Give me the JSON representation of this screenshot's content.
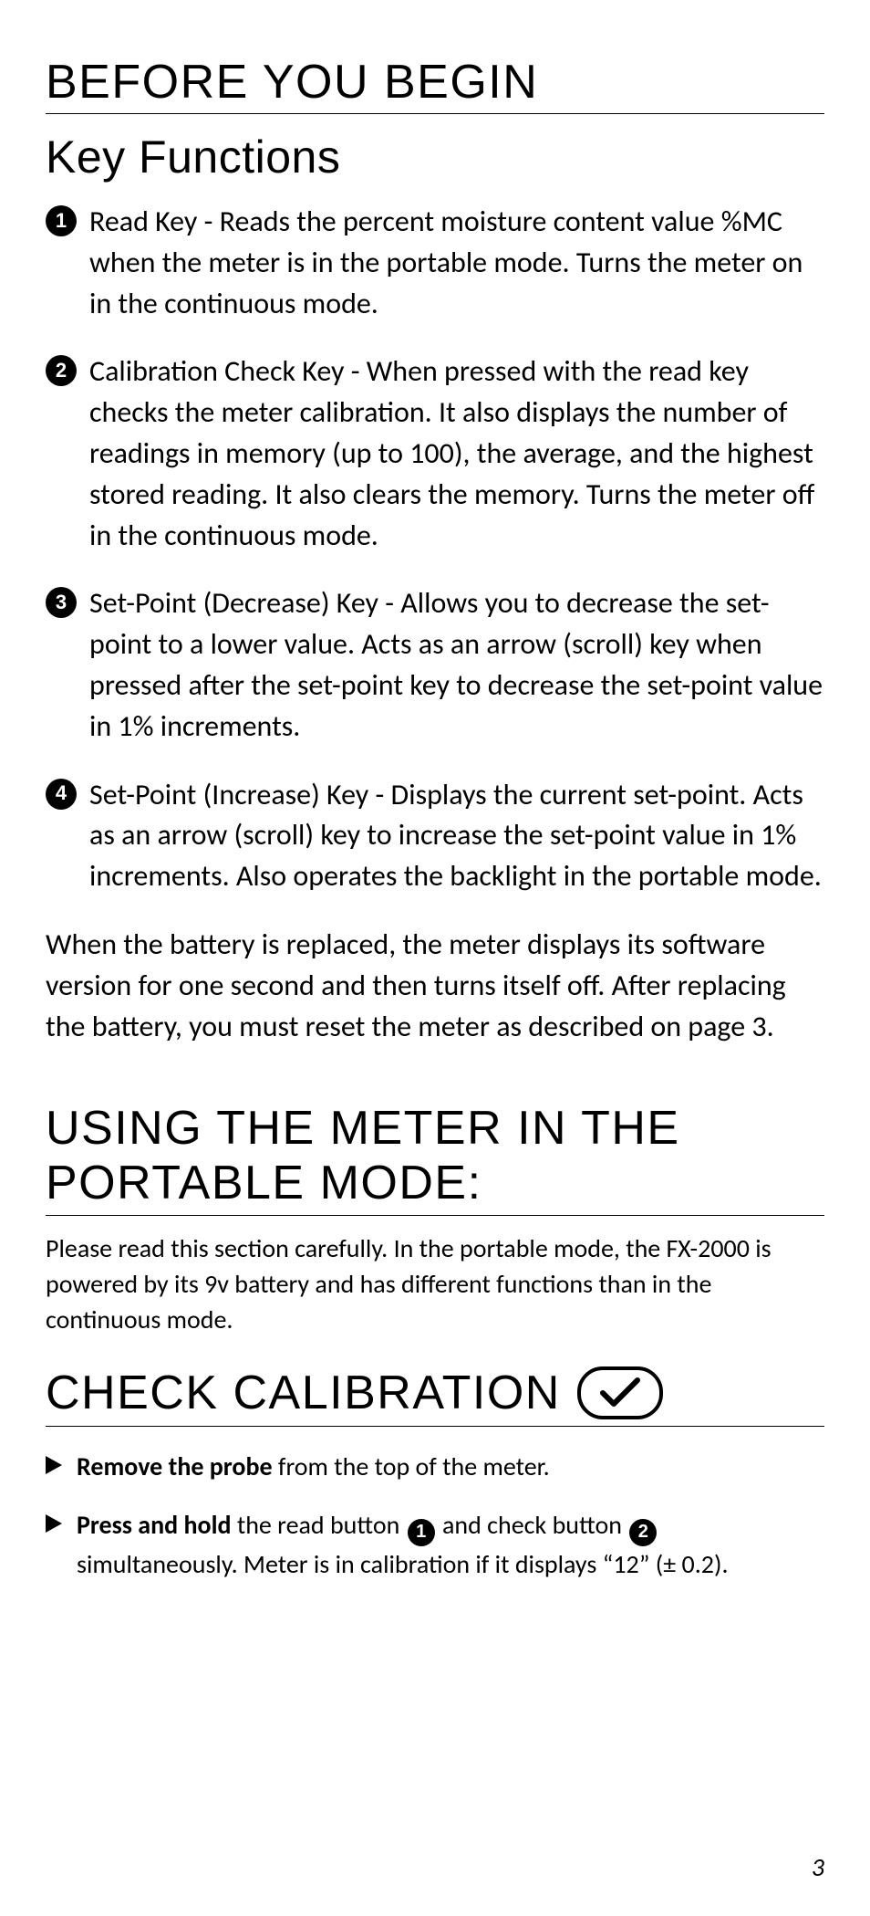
{
  "section1": {
    "title": "BEFORE YOU BEGIN",
    "subtitle": "Key Functions",
    "items": [
      {
        "num": "1",
        "text": "Read Key - Reads the percent moisture content value %MC when the meter is in the portable mode. Turns the meter on in the continuous mode."
      },
      {
        "num": "2",
        "text": "Calibration Check Key - When pressed with the read key checks the meter calibration. It also displays the number of readings in memory (up to 100), the average, and the highest stored reading. It also clears the memory. Turns the meter off in the continuous mode."
      },
      {
        "num": "3",
        "text": "Set-Point (Decrease) Key - Allows you to decrease the set-point to a lower value. Acts as an arrow (scroll) key when pressed after the set-point key to decrease the set-point value in 1% increments."
      },
      {
        "num": "4",
        "text": "Set-Point (Increase) Key - Displays the current set-point. Acts as an arrow (scroll) key to increase the set-point value in 1% increments. Also operates the backlight in the portable mode."
      }
    ],
    "note": "When the battery is replaced, the meter displays its software version for one second and then turns itself off. After replacing the battery, you must reset the meter as described on page 3."
  },
  "section2": {
    "title": "USING THE METER IN THE PORTABLE MODE:",
    "intro": "Please read this section carefully. In the portable mode, the FX-2000 is powered by its 9v battery and has different functions than in the continuous mode."
  },
  "section3": {
    "title": "CHECK CALIBRATION",
    "check_icon": "checkmark-in-oval",
    "steps": [
      {
        "lead_bold": "Remove the probe",
        "rest": " from the top of the meter."
      },
      {
        "lead_bold": "Press and hold",
        "mid1": " the read button ",
        "b1": "1",
        "mid2": " and check button ",
        "b2": "2",
        "rest": " simultaneously. Meter is in calibration if it displays “12” (± 0.2)."
      }
    ]
  },
  "page_number": "3"
}
